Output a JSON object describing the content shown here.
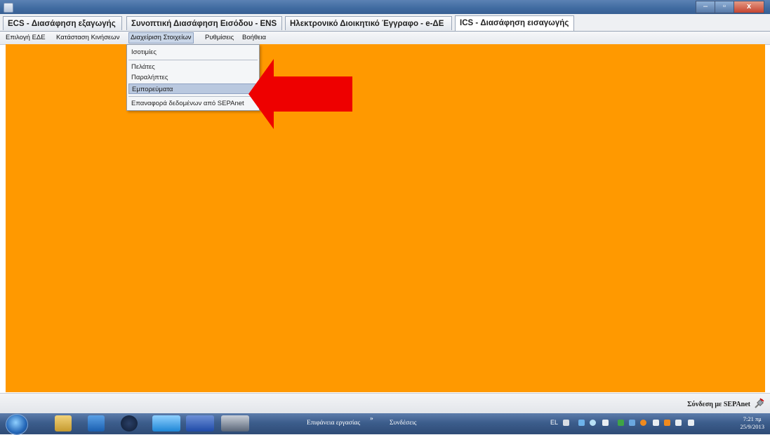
{
  "window": {
    "minimize_label": "–",
    "restore_label": "▫",
    "close_label": "x"
  },
  "tabs": [
    "ECS - Διασάφηση εξαγωγής",
    "Συνοπτική Διασάφηση Εισόδου - ENS",
    "Ηλεκτρονικό Διοικητικό Έγγραφο - e-ΔΕ",
    "ICS - Διασάφηση εισαγωγής"
  ],
  "menu": [
    "Επιλογή ΕΔΕ",
    "Κατάσταση Κινήσεων",
    "Διαχείριση Στοιχείων",
    "Ρυθμίσεις",
    "Βοήθεια"
  ],
  "dropdown": {
    "items": [
      "Ισοτιμίες",
      "Πελάτες",
      "Παραλήπτες",
      "Εμπορεύματα",
      "Επαναφορά δεδομένων από SEPAnet"
    ],
    "highlighted": "Εμπορεύματα"
  },
  "status": {
    "text": "Σύνδεση με SEPAnet"
  },
  "taskbar": {
    "desktop_label": "Επιφάνεια εργασίας",
    "chevron": "»",
    "connections_label": "Συνδέσεις",
    "language": "EL",
    "time": "7:21 πμ",
    "date": "25/9/2013"
  },
  "colors": {
    "content_bg": "#ff9900",
    "arrow": "#ee0000",
    "highlight": "#b9c8df"
  }
}
